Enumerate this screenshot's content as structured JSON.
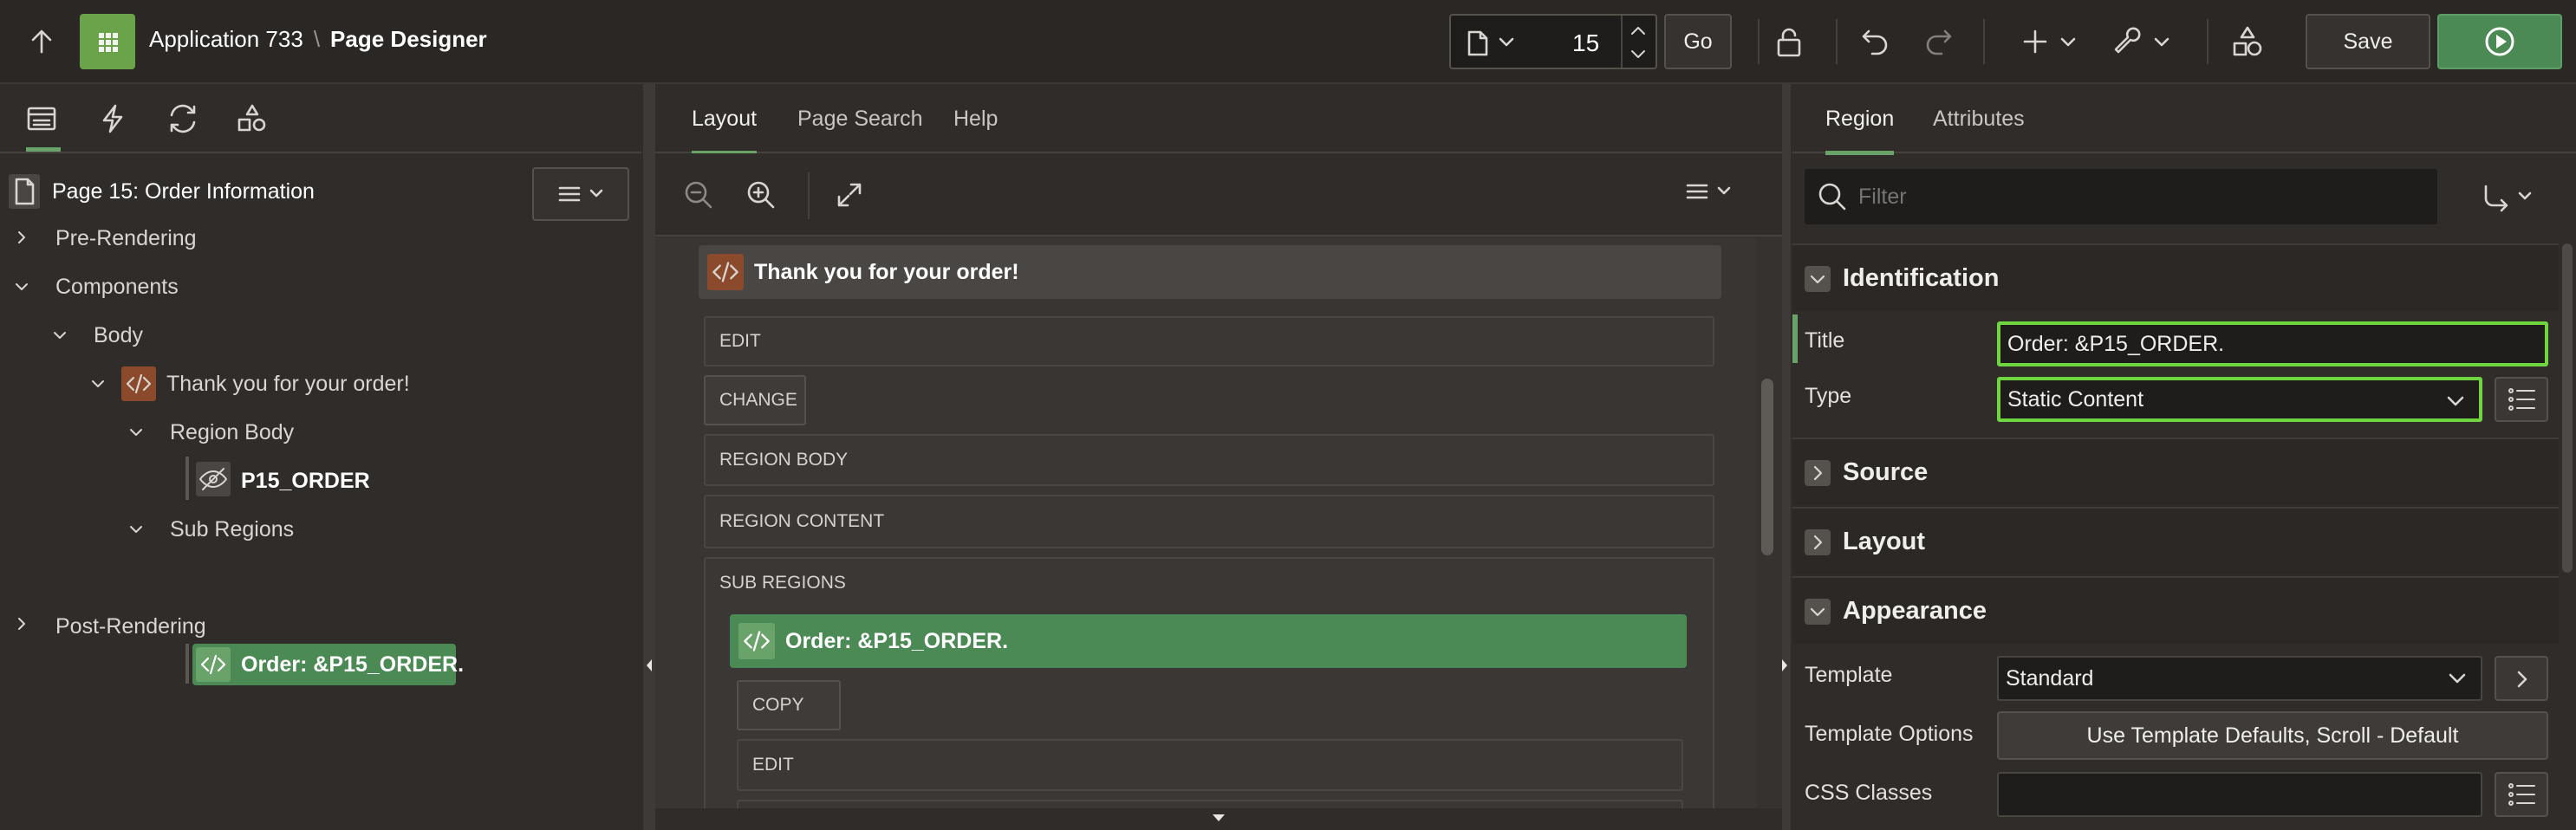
{
  "header": {
    "app_name": "Application 733",
    "separator": "\\",
    "page_designer": "Page Designer",
    "page_number": "15",
    "go_label": "Go",
    "save_label": "Save"
  },
  "left": {
    "page_title": "Page 15: Order Information",
    "tree": {
      "pre_rendering": "Pre-Rendering",
      "components": "Components",
      "body": "Body",
      "region": "Thank you for your order!",
      "region_body": "Region Body",
      "item": "P15_ORDER",
      "sub_regions": "Sub Regions",
      "sub_region": "Order: &P15_ORDER.",
      "post_rendering": "Post-Rendering"
    }
  },
  "center": {
    "tabs": [
      "Layout",
      "Page Search",
      "Help"
    ],
    "region_title": "Thank you for your order!",
    "rows": {
      "edit": "EDIT",
      "change": "CHANGE",
      "region_body": "REGION BODY",
      "region_content": "REGION CONTENT",
      "sub_regions": "SUB REGIONS",
      "copy": "COPY",
      "edit2": "EDIT"
    },
    "sub_region_title": "Order: &P15_ORDER."
  },
  "right": {
    "tabs": [
      "Region",
      "Attributes"
    ],
    "filter_placeholder": "Filter",
    "sections": {
      "identification": "Identification",
      "source": "Source",
      "layout": "Layout",
      "appearance": "Appearance"
    },
    "props": {
      "title_label": "Title",
      "title_value": "Order: &P15_ORDER.",
      "type_label": "Type",
      "type_value": "Static Content",
      "template_label": "Template",
      "template_value": "Standard",
      "template_options_label": "Template Options",
      "template_options_value": "Use Template Defaults, Scroll - Default",
      "css_classes_label": "CSS Classes"
    }
  },
  "colors": {
    "accent_green": "#4b8a55",
    "highlight": "#6fd63f",
    "region_icon": "#8a4a2b"
  }
}
